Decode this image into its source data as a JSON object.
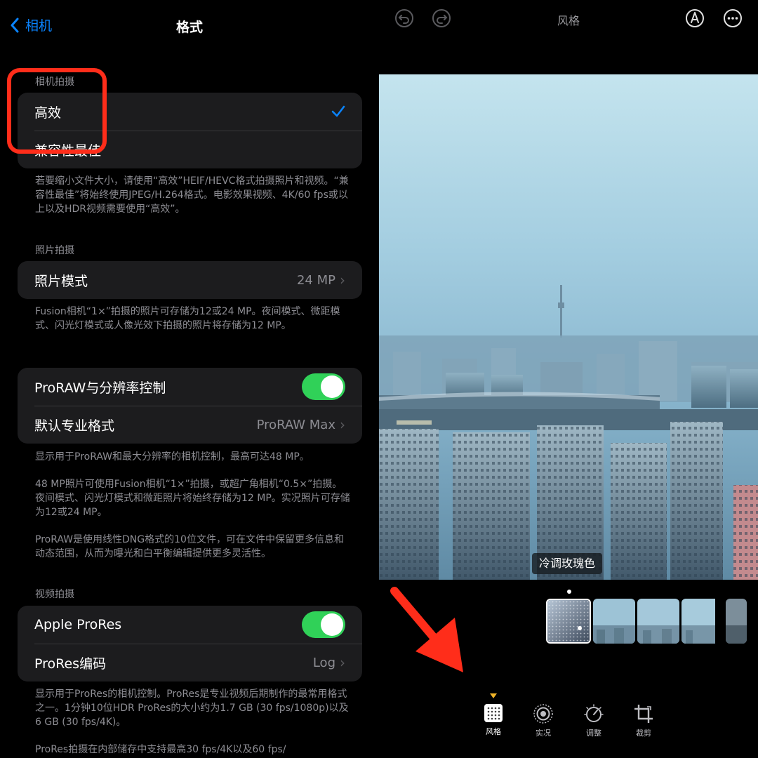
{
  "settings": {
    "back_label": "相机",
    "title": "格式",
    "camera_capture": {
      "header": "相机拍摄",
      "options": [
        {
          "label": "高效",
          "selected": true
        },
        {
          "label": "兼容性最佳",
          "selected": false
        }
      ],
      "footer": "若要缩小文件大小，请使用“高效”HEIF/HEVC格式拍摄照片和视频。“兼容性最佳”将始终使用JPEG/H.264格式。电影效果视频、4K/60 fps或以上以及HDR视频需要使用“高效”。"
    },
    "photo_capture": {
      "header": "照片拍摄",
      "photo_mode_label": "照片模式",
      "photo_mode_value": "24 MP",
      "footer": "Fusion相机“1×”拍摄的照片可存储为12或24 MP。夜间模式、微距模式、闪光灯模式或人像光效下拍摄的照片将存储为12 MP。"
    },
    "proraw": {
      "toggle_label": "ProRAW与分辨率控制",
      "toggle_on": true,
      "default_label": "默认专业格式",
      "default_value": "ProRAW Max",
      "footer_1": "显示用于ProRAW和最大分辨率的相机控制，最高可达48 MP。",
      "footer_2": "48 MP照片可使用Fusion相机“1×”拍摄，或超广角相机“0.5×”拍摄。夜间模式、闪光灯模式和微距照片将始终存储为12 MP。实况照片可存储为12或24 MP。",
      "footer_3": "ProRAW是使用线性DNG格式的10位文件，可在文件中保留更多信息和动态范围，从而为曝光和白平衡编辑提供更多灵活性。"
    },
    "video_capture": {
      "header": "视频拍摄",
      "prores_label": "Apple ProRes",
      "prores_on": true,
      "encoding_label": "ProRes编码",
      "encoding_value": "Log",
      "footer_1": "显示用于ProRes的相机控制。ProRes是专业视频后期制作的最常用格式之一。1分钟10位HDR ProRes的大小约为1.7 GB (30 fps/1080p)以及6 GB (30 fps/4K)。",
      "footer_2": "ProRes拍摄在内部储存中支持最高30 fps/4K以及60 fps/"
    }
  },
  "editor": {
    "title": "风格",
    "style_name": "冷调玫瑰色",
    "tabs": [
      {
        "label": "风格",
        "active": true
      },
      {
        "label": "实况",
        "active": false
      },
      {
        "label": "调整",
        "active": false
      },
      {
        "label": "裁剪",
        "active": false
      }
    ]
  },
  "colors": {
    "accent": "#0a84ff",
    "toggle_on": "#30d158",
    "annotation": "#ff2d1a",
    "group_bg": "#1c1c1e"
  }
}
